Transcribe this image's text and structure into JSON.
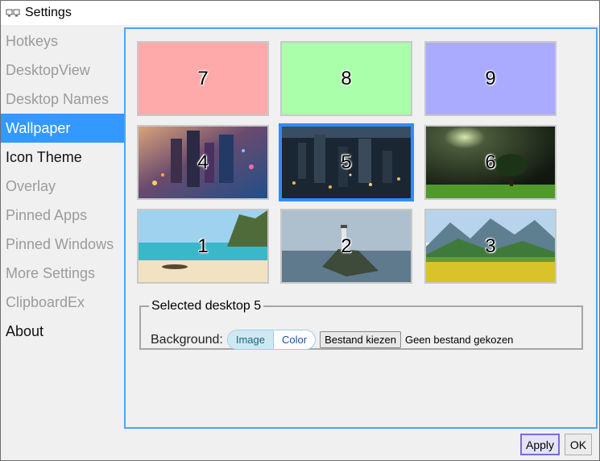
{
  "window": {
    "title": "Settings",
    "icon": "monitor-dual-icon"
  },
  "sidebar": {
    "items": [
      {
        "label": "Hotkeys",
        "state": "dim"
      },
      {
        "label": "DesktopView",
        "state": "dim"
      },
      {
        "label": "Desktop Names",
        "state": "dim"
      },
      {
        "label": "Wallpaper",
        "state": "active"
      },
      {
        "label": "Icon Theme",
        "state": "dark"
      },
      {
        "label": "Overlay",
        "state": "dim"
      },
      {
        "label": "Pinned Apps",
        "state": "dim"
      },
      {
        "label": "Pinned Windows",
        "state": "dim"
      },
      {
        "label": "More Settings",
        "state": "dim"
      },
      {
        "label": "ClipboardEx",
        "state": "dim"
      },
      {
        "label": "About",
        "state": "dark"
      }
    ]
  },
  "wallpapers": {
    "tiles": [
      {
        "number": "7",
        "kind": "solid",
        "color": "#ffaaaa"
      },
      {
        "number": "8",
        "kind": "solid",
        "color": "#aaffaa"
      },
      {
        "number": "9",
        "kind": "solid",
        "color": "#aaaaff"
      },
      {
        "number": "4",
        "kind": "city-aerial-image"
      },
      {
        "number": "5",
        "kind": "city-night-image",
        "selected": true
      },
      {
        "number": "6",
        "kind": "tree-night-image"
      },
      {
        "number": "1",
        "kind": "beach-image"
      },
      {
        "number": "2",
        "kind": "lighthouse-image"
      },
      {
        "number": "3",
        "kind": "mountain-meadow-image"
      }
    ]
  },
  "selected_group": {
    "legend": "Selected desktop 5",
    "background_label": "Background:",
    "toggle": {
      "image": "Image",
      "color": "Color",
      "selected": "Image"
    },
    "file_button": "Bestand kiezen",
    "file_status": "Geen bestand gekozen"
  },
  "footer": {
    "apply": "Apply",
    "ok": "OK"
  },
  "colors": {
    "accent": "#3399ff",
    "selection": "#2f8cff",
    "apply_border": "#7a6cd9"
  }
}
